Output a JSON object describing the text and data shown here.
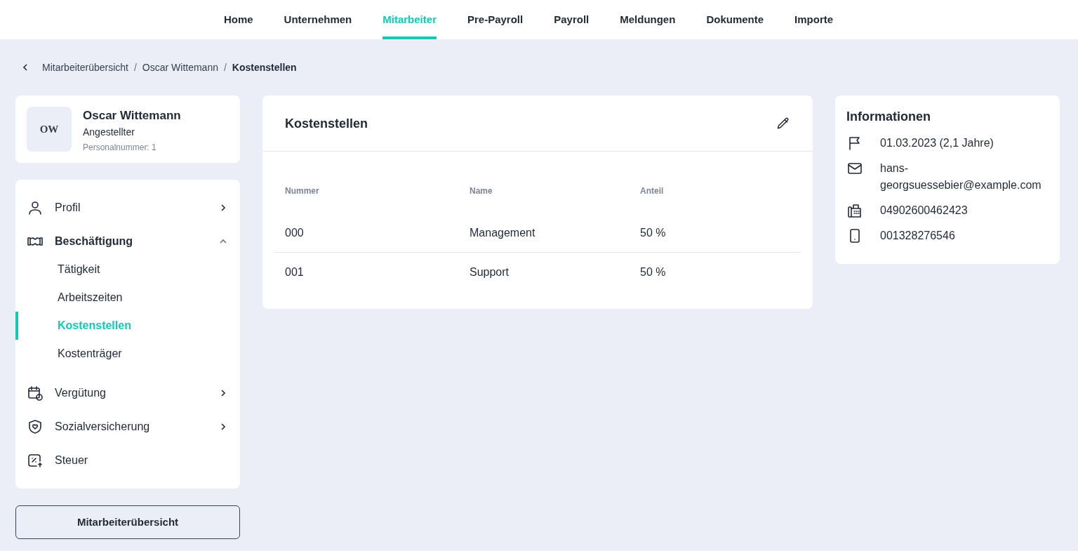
{
  "nav": [
    {
      "label": "Home",
      "selected": false
    },
    {
      "label": "Unternehmen",
      "selected": false
    },
    {
      "label": "Mitarbeiter",
      "selected": true
    },
    {
      "label": "Pre-Payroll",
      "selected": false
    },
    {
      "label": "Payroll",
      "selected": false
    },
    {
      "label": "Meldungen",
      "selected": false
    },
    {
      "label": "Dokumente",
      "selected": false
    },
    {
      "label": "Importe",
      "selected": false
    }
  ],
  "breadcrumb": [
    "Mitarbeiterübersicht",
    "Oscar Wittemann",
    "Kostenstellen"
  ],
  "breadcrumb_separator": "/",
  "employee": {
    "initials": "OW",
    "name": "Oscar Wittemann",
    "role": "Angestellter",
    "number_label": "Personalnummer:",
    "number": "1"
  },
  "sidebar": {
    "items": [
      {
        "label": "Profil",
        "expanded": false
      },
      {
        "label": "Beschäftigung",
        "expanded": true,
        "children": [
          {
            "label": "Tätigkeit",
            "selected": false
          },
          {
            "label": "Arbeitszeiten",
            "selected": false
          },
          {
            "label": "Kostenstellen",
            "selected": true
          },
          {
            "label": "Kostenträger",
            "selected": false
          }
        ]
      },
      {
        "label": "Vergütung",
        "expanded": false
      },
      {
        "label": "Sozialversicherung",
        "expanded": false
      },
      {
        "label": "Steuer"
      }
    ]
  },
  "overview_button": "Mitarbeiterübersicht",
  "cost_centers": {
    "title": "Kostenstellen",
    "columns": [
      "Nummer",
      "Name",
      "Anteil"
    ],
    "rows": [
      [
        "000",
        "Management",
        "50 %"
      ],
      [
        "001",
        "Support",
        "50 %"
      ]
    ]
  },
  "info": {
    "title": "Informationen",
    "rows": [
      "01.03.2023 (2,1 Jahre)",
      "hans-georgsuessebier@example.com",
      "04902600462423",
      "001328276546"
    ]
  }
}
